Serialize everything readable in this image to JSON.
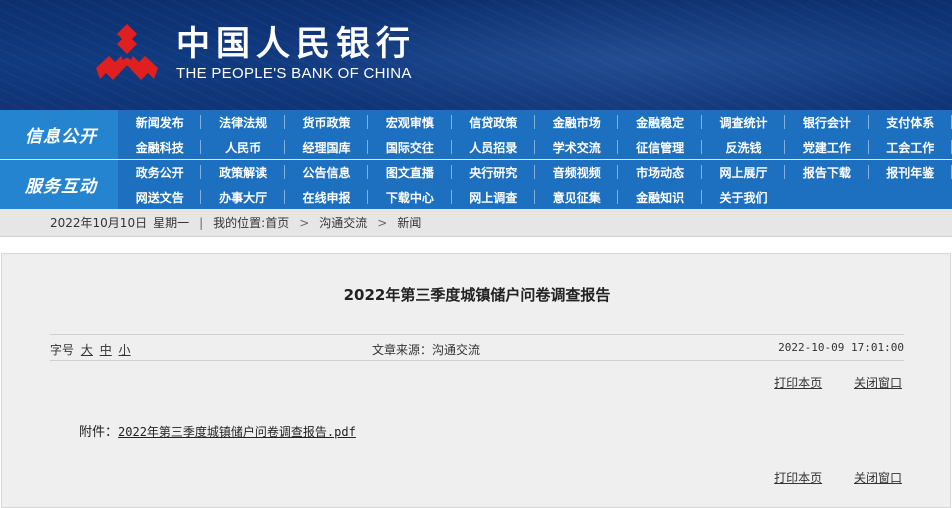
{
  "header": {
    "bank_name_cn": "中国人民银行",
    "bank_name_en": "THE PEOPLE'S BANK OF CHINA"
  },
  "nav": {
    "section1_title": "信息公开",
    "section2_title": "服务互动",
    "rows": [
      [
        "新闻发布",
        "法律法规",
        "货币政策",
        "宏观审慎",
        "信贷政策",
        "金融市场",
        "金融稳定",
        "调查统计",
        "银行会计",
        "支付体系"
      ],
      [
        "金融科技",
        "人民币",
        "经理国库",
        "国际交往",
        "人员招录",
        "学术交流",
        "征信管理",
        "反洗钱",
        "党建工作",
        "工会工作"
      ],
      [
        "政务公开",
        "政策解读",
        "公告信息",
        "图文直播",
        "央行研究",
        "音频视频",
        "市场动态",
        "网上展厅",
        "报告下载",
        "报刊年鉴"
      ],
      [
        "网送文告",
        "办事大厅",
        "在线申报",
        "下载中心",
        "网上调查",
        "意见征集",
        "金融知识",
        "关于我们",
        "",
        ""
      ]
    ]
  },
  "breadcrumb": {
    "date": "2022年10月10日",
    "weekday": "星期一",
    "sep": "|",
    "location_label": "我的位置:首页",
    "arrow": ">",
    "level1": "沟通交流",
    "level2": "新闻"
  },
  "article": {
    "title": "2022年第三季度城镇储户问卷调查报告",
    "font_size_label": "字号",
    "font_large": "大",
    "font_medium": "中",
    "font_small": "小",
    "source": "文章来源：沟通交流",
    "date": "2022-10-09 17:01:00",
    "print_label": "打印本页",
    "close_label": "关闭窗口",
    "attachment_label": "附件：",
    "attachment_name": "2022年第三季度城镇储户问卷调查报告.pdf"
  },
  "colors": {
    "banner": "#0f3477",
    "nav": "#1d70c0",
    "nav_side": "#2584cf",
    "logo_red": "#e02020"
  }
}
